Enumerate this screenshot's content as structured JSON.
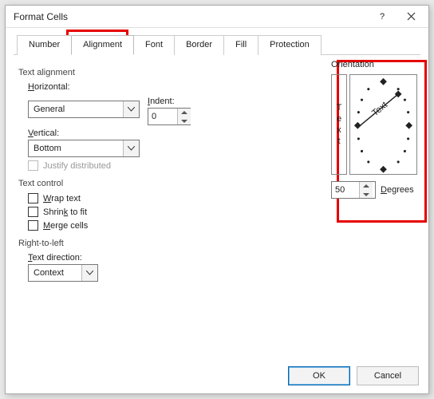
{
  "titlebar": {
    "title": "Format Cells"
  },
  "tabs": {
    "number": "Number",
    "alignment": "Alignment",
    "font": "Font",
    "border": "Border",
    "fill": "Fill",
    "protection": "Protection"
  },
  "align": {
    "group": "Text alignment",
    "horizontal_label_u": "H",
    "horizontal_label_r": "orizontal:",
    "horizontal_value": "General",
    "vertical_label_u": "V",
    "vertical_label_r": "ertical:",
    "vertical_value": "Bottom",
    "indent_label_u": "I",
    "indent_label_r": "ndent:",
    "indent_value": "0",
    "justify_label": "Justify distributed"
  },
  "ctrl": {
    "group": "Text control",
    "wrap_u": "W",
    "wrap_r": "rap text",
    "shrink_pre": "Shrin",
    "shrink_u": "k",
    "shrink_post": " to fit",
    "merge_u": "M",
    "merge_r": "erge cells"
  },
  "rtl": {
    "group": "Right-to-left",
    "textdir_u": "T",
    "textdir_r": "ext direction:",
    "textdir_value": "Context"
  },
  "orient": {
    "group": "Orientation",
    "vertical_text": "Text",
    "dial_text": "Text",
    "degrees_value": "50",
    "degrees_u": "D",
    "degrees_r": "egrees"
  },
  "buttons": {
    "ok": "OK",
    "cancel": "Cancel"
  }
}
